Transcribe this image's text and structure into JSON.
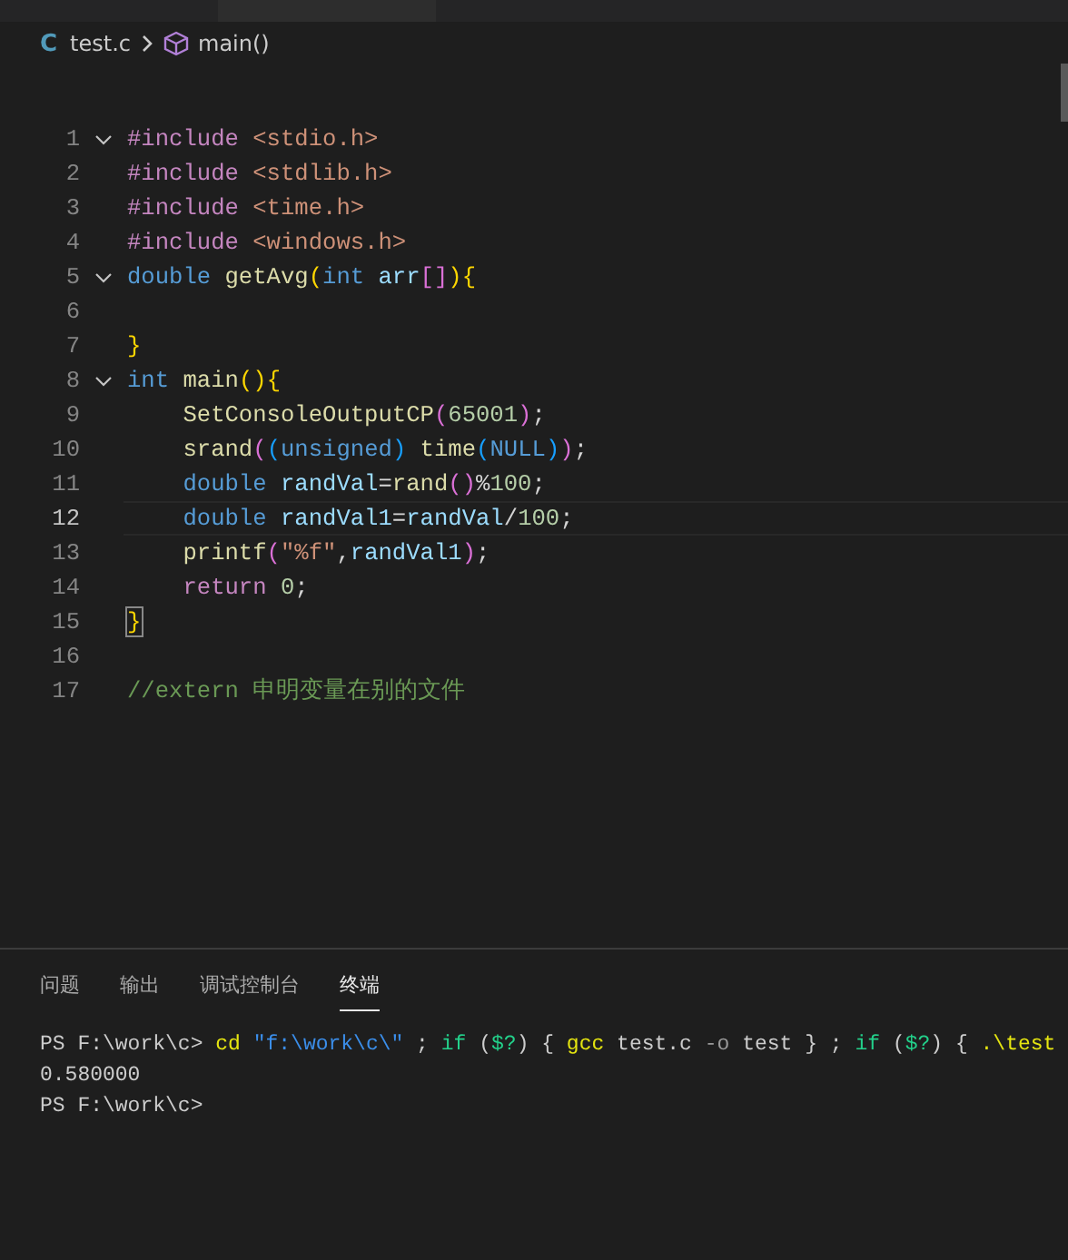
{
  "breadcrumb": {
    "file_icon": "C",
    "file": "test.c",
    "symbol": "main()"
  },
  "editor": {
    "lines": [
      {
        "number": "1",
        "foldable": true,
        "current": false,
        "tokens": [
          {
            "text": "#include",
            "kind": "directive"
          },
          {
            "text": " <stdio.h>",
            "kind": "string"
          }
        ]
      },
      {
        "number": "2",
        "foldable": false,
        "current": false,
        "tokens": [
          {
            "text": "#include",
            "kind": "directive"
          },
          {
            "text": " <stdlib.h>",
            "kind": "string"
          }
        ]
      },
      {
        "number": "3",
        "foldable": false,
        "current": false,
        "tokens": [
          {
            "text": "#include",
            "kind": "directive"
          },
          {
            "text": " <time.h>",
            "kind": "string"
          }
        ]
      },
      {
        "number": "4",
        "foldable": false,
        "current": false,
        "tokens": [
          {
            "text": "#include",
            "kind": "directive"
          },
          {
            "text": " <windows.h>",
            "kind": "string"
          }
        ]
      },
      {
        "number": "5",
        "foldable": true,
        "current": false,
        "tokens": [
          {
            "text": "double",
            "kind": "type"
          },
          {
            "text": " getAvg",
            "kind": "function"
          },
          {
            "text": "(",
            "kind": "bracket1"
          },
          {
            "text": "int",
            "kind": "type"
          },
          {
            "text": " arr",
            "kind": "variable"
          },
          {
            "text": "[]",
            "kind": "bracket2"
          },
          {
            "text": ")",
            "kind": "bracket1"
          },
          {
            "text": "{",
            "kind": "bracket1"
          }
        ]
      },
      {
        "number": "6",
        "foldable": false,
        "current": false
      },
      {
        "number": "7",
        "foldable": false,
        "current": false,
        "tokens": [
          {
            "text": "}",
            "kind": "bracket1"
          }
        ]
      },
      {
        "number": "8",
        "foldable": true,
        "current": false,
        "tokens": [
          {
            "text": "int",
            "kind": "type"
          },
          {
            "text": " main",
            "kind": "function"
          },
          {
            "text": "()",
            "kind": "bracket1"
          },
          {
            "text": "{",
            "kind": "bracket1"
          }
        ]
      },
      {
        "number": "9",
        "foldable": false,
        "current": false,
        "tokens": [
          {
            "text": "    SetConsoleOutputCP",
            "kind": "function"
          },
          {
            "text": "(",
            "kind": "bracket2"
          },
          {
            "text": "65001",
            "kind": "number"
          },
          {
            "text": ")",
            "kind": "bracket2"
          },
          {
            "text": ";",
            "kind": "plain"
          }
        ]
      },
      {
        "number": "10",
        "foldable": false,
        "current": false,
        "tokens": [
          {
            "text": "    srand",
            "kind": "function"
          },
          {
            "text": "(",
            "kind": "bracket2"
          },
          {
            "text": "(",
            "kind": "bracket3"
          },
          {
            "text": "unsigned",
            "kind": "type"
          },
          {
            "text": ")",
            "kind": "bracket3"
          },
          {
            "text": " time",
            "kind": "function"
          },
          {
            "text": "(",
            "kind": "bracket3"
          },
          {
            "text": "NULL",
            "kind": "type"
          },
          {
            "text": ")",
            "kind": "bracket3"
          },
          {
            "text": ")",
            "kind": "bracket2"
          },
          {
            "text": ";",
            "kind": "plain"
          }
        ]
      },
      {
        "number": "11",
        "foldable": false,
        "current": false,
        "tokens": [
          {
            "text": "    double",
            "kind": "type"
          },
          {
            "text": " randVal",
            "kind": "variable"
          },
          {
            "text": "=",
            "kind": "plain"
          },
          {
            "text": "rand",
            "kind": "function"
          },
          {
            "text": "()",
            "kind": "bracket2"
          },
          {
            "text": "%",
            "kind": "plain"
          },
          {
            "text": "100",
            "kind": "number"
          },
          {
            "text": ";",
            "kind": "plain"
          }
        ]
      },
      {
        "number": "12",
        "foldable": false,
        "current": true,
        "tokens": [
          {
            "text": "    double",
            "kind": "type"
          },
          {
            "text": " randVal1",
            "kind": "variable"
          },
          {
            "text": "=",
            "kind": "plain"
          },
          {
            "text": "randVal",
            "kind": "variable"
          },
          {
            "text": "/",
            "kind": "plain"
          },
          {
            "text": "100",
            "kind": "number"
          },
          {
            "text": ";",
            "kind": "plain"
          }
        ]
      },
      {
        "number": "13",
        "foldable": false,
        "current": false,
        "tokens": [
          {
            "text": "    printf",
            "kind": "function"
          },
          {
            "text": "(",
            "kind": "bracket2"
          },
          {
            "text": "\"%f\"",
            "kind": "string"
          },
          {
            "text": ",",
            "kind": "plain"
          },
          {
            "text": "randVal1",
            "kind": "variable"
          },
          {
            "text": ")",
            "kind": "bracket2"
          },
          {
            "text": ";",
            "kind": "plain"
          }
        ]
      },
      {
        "number": "14",
        "foldable": false,
        "current": false,
        "tokens": [
          {
            "text": "    return",
            "kind": "control"
          },
          {
            "text": " 0",
            "kind": "number"
          },
          {
            "text": ";",
            "kind": "plain"
          }
        ]
      },
      {
        "number": "15",
        "foldable": false,
        "current": false,
        "tokens": [
          {
            "text": "}",
            "kind": "bracket-match"
          }
        ]
      },
      {
        "number": "16",
        "foldable": false,
        "current": false
      },
      {
        "number": "17",
        "foldable": false,
        "current": false,
        "tokens": [
          {
            "text": "//extern 申明变量在别的文件",
            "kind": "comment"
          }
        ]
      }
    ]
  },
  "panel": {
    "tabs": [
      {
        "label": "问题",
        "selected": false
      },
      {
        "label": "输出",
        "selected": false
      },
      {
        "label": "调试控制台",
        "selected": false
      },
      {
        "label": "终端",
        "selected": true
      }
    ],
    "terminal": [
      [
        {
          "text": "PS F:\\work\\c>",
          "kind": "plain"
        },
        {
          "text": " cd",
          "kind": "command"
        },
        {
          "text": " \"f:\\work\\c\\\"",
          "kind": "string"
        },
        {
          "text": " ;",
          "kind": "plain"
        },
        {
          "text": " if",
          "kind": "keyword"
        },
        {
          "text": " (",
          "kind": "plain"
        },
        {
          "text": "$?",
          "kind": "keyword"
        },
        {
          "text": ") {",
          "kind": "plain"
        },
        {
          "text": " gcc",
          "kind": "command"
        },
        {
          "text": " test.c",
          "kind": "plain"
        },
        {
          "text": " -o",
          "kind": "param"
        },
        {
          "text": " test } ;",
          "kind": "plain"
        },
        {
          "text": " if",
          "kind": "keyword"
        },
        {
          "text": " (",
          "kind": "plain"
        },
        {
          "text": "$?",
          "kind": "keyword"
        },
        {
          "text": ") {",
          "kind": "plain"
        },
        {
          "text": " .\\test",
          "kind": "command"
        }
      ],
      [
        {
          "text": "0.580000",
          "kind": "plain"
        }
      ],
      [
        {
          "text": "PS F:\\work\\c>",
          "kind": "plain"
        }
      ]
    ]
  }
}
